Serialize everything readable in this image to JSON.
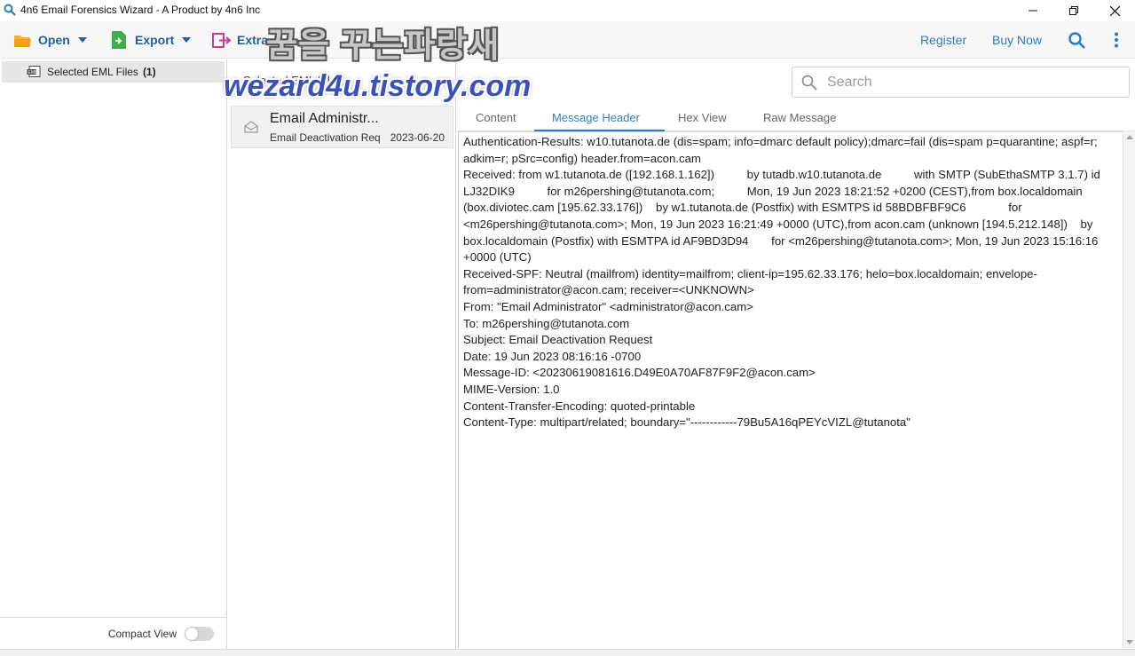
{
  "window": {
    "title": "4n6 Email Forensics Wizard - A Product by 4n6 Inc"
  },
  "toolbar": {
    "open_label": "Open",
    "export_label": "Export",
    "extract_label": "Extra",
    "register_label": "Register",
    "buy_now_label": "Buy Now"
  },
  "tree": {
    "item_label": "Selected EML Files",
    "item_count": "(1)"
  },
  "compact_view": {
    "label": "Compact View",
    "enabled": false
  },
  "mail_list": {
    "header": "Selected EML Files",
    "items": [
      {
        "from": "Email Administr...",
        "subject": "Email Deactivation Req",
        "date": "2023-06-20"
      }
    ]
  },
  "search": {
    "placeholder": "Search"
  },
  "tabs": [
    {
      "label": "Content",
      "active": false
    },
    {
      "label": "Message Header",
      "active": true
    },
    {
      "label": "Hex View",
      "active": false
    },
    {
      "label": "Raw Message",
      "active": false
    }
  ],
  "message_header": {
    "text": "Authentication-Results: w10.tutanota.de (dis=spam; info=dmarc default policy);dmarc=fail (dis=spam p=quarantine; aspf=r; adkim=r; pSrc=config) header.from=acon.cam\nReceived: from w1.tutanota.de ([192.168.1.162])          by tutadb.w10.tutanota.de          with SMTP (SubEthaSMTP 3.1.7) id LJ32DIK9          for m26pershing@tutanota.com;          Mon, 19 Jun 2023 18:21:52 +0200 (CEST),from box.localdomain (box.diviotec.cam [195.62.33.176])    by w1.tutanota.de (Postfix) with ESMTPS id 58BDBFBF9C6             for <m26pershing@tutanota.com>; Mon, 19 Jun 2023 16:21:49 +0000 (UTC),from acon.cam (unknown [194.5.212.148])    by box.localdomain (Postfix) with ESMTPA id AF9BD3D94       for <m26pershing@tutanota.com>; Mon, 19 Jun 2023 15:16:16 +0000 (UTC)\nReceived-SPF: Neutral (mailfrom) identity=mailfrom; client-ip=195.62.33.176; helo=box.localdomain; envelope-from=administrator@acon.cam; receiver=<UNKNOWN>\nFrom: \"Email Administrator\" <administrator@acon.cam>\nTo: m26pershing@tutanota.com\nSubject: Email Deactivation Request\nDate: 19 Jun 2023 08:16:16 -0700\nMessage-ID: <20230619081616.D49E0A70AF87F9F2@acon.cam>\nMIME-Version: 1.0\nContent-Transfer-Encoding: quoted-printable\nContent-Type: multipart/related; boundary=\"------------79Bu5A16qPEYcVIZL@tutanota\""
  },
  "watermark": {
    "line1": "꿈을 꾸는파랑새",
    "line2": "wezard4u.tistory.com"
  },
  "icons": {
    "app": "search-icon",
    "open": "folder-icon",
    "export": "export-file-icon",
    "extract": "extract-icon",
    "search": "search-icon",
    "more": "more-vertical-icon"
  },
  "colors": {
    "accent": "#2f7fc6",
    "toolbar_text": "#1f5f9f",
    "open_icon": "#f0a020",
    "export_icon": "#3fae49",
    "extract_icon": "#c23c9e"
  }
}
